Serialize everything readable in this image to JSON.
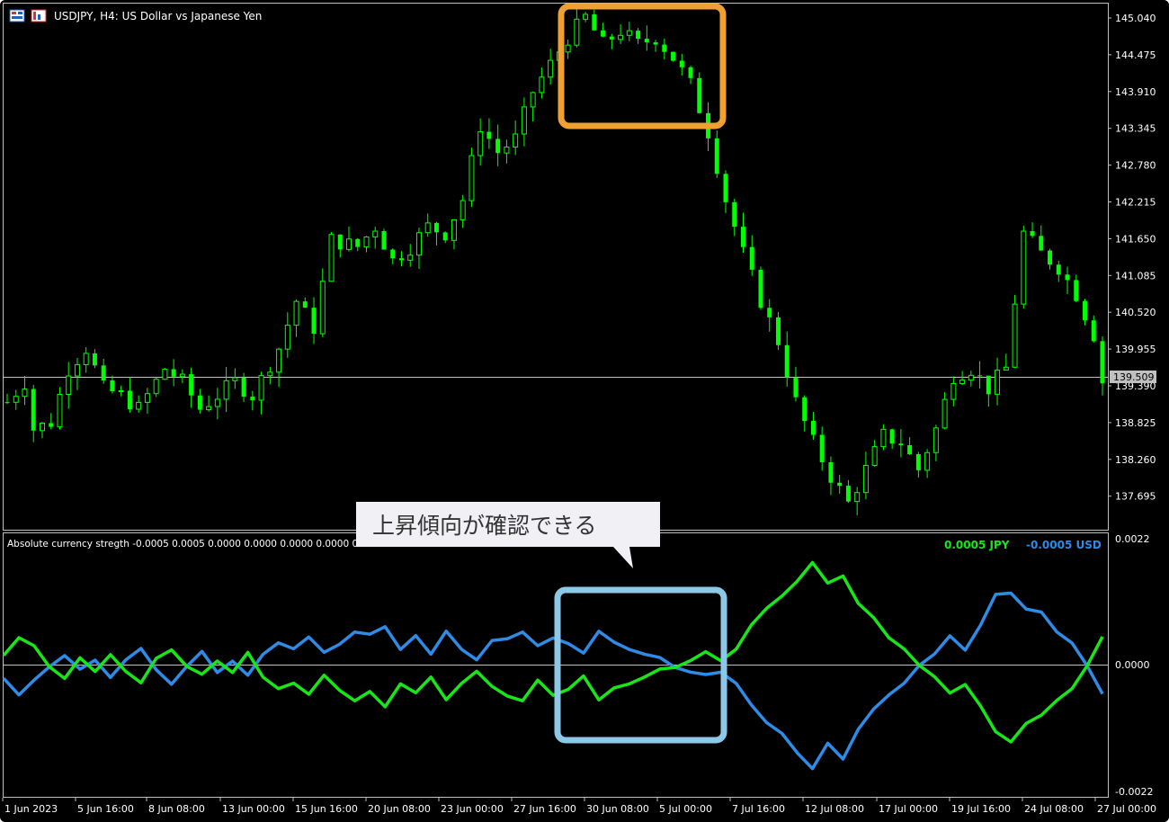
{
  "window": {
    "symbol_title": "USDJPY, H4:  US Dollar vs Japanese Yen",
    "current_price": "139.509"
  },
  "colors": {
    "background": "#000000",
    "candle": "#00ff00",
    "jpy": "#19e619",
    "usd": "#2e8be6",
    "grid": "#c0c0c0",
    "highlight_top": "#f0a030",
    "highlight_bottom": "#8cc8e8",
    "price_tag_bg": "#c0c0c0"
  },
  "price_axis": [
    "145.040",
    "144.475",
    "143.910",
    "143.345",
    "142.780",
    "142.215",
    "141.650",
    "141.085",
    "140.520",
    "139.955",
    "139.390",
    "138.825",
    "138.260",
    "137.695"
  ],
  "indicator": {
    "label": "Absolute currency stregth -0.0005 0.0005 0.0000 0.0000 0.0000 0.0000 0.0000 0.0000",
    "jpy_legend": "0.0005 JPY",
    "usd_legend": "-0.0005 USD",
    "axis": [
      "0.0022",
      "0.0000",
      "-0.0022"
    ]
  },
  "time_axis": [
    "1 Jun 2023",
    "5 Jun 16:00",
    "8 Jun 08:00",
    "13 Jun 00:00",
    "15 Jun 16:00",
    "20 Jun 08:00",
    "23 Jun 00:00",
    "27 Jun 16:00",
    "30 Jun 08:00",
    "5 Jul 00:00",
    "7 Jul 16:00",
    "12 Jul 08:00",
    "17 Jul 00:00",
    "19 Jul 16:00",
    "24 Jul 08:00",
    "27 Jul 00:00"
  ],
  "callout": {
    "text": "上昇傾向が確認できる"
  },
  "chart_data": [
    {
      "type": "candlestick",
      "title": "USDJPY, H4:  US Dollar vs Japanese Yen",
      "ylim": [
        137.45,
        145.15
      ],
      "x": [
        "1 Jun 2023",
        "5 Jun 16:00",
        "8 Jun 08:00",
        "13 Jun 00:00",
        "15 Jun 16:00",
        "20 Jun 08:00",
        "23 Jun 00:00",
        "27 Jun 16:00",
        "30 Jun 08:00",
        "5 Jul 00:00",
        "7 Jul 16:00",
        "12 Jul 08:00",
        "17 Jul 00:00",
        "19 Jul 16:00",
        "24 Jul 08:00",
        "27 Jul 00:00"
      ],
      "path": [
        [
          0,
          139.3
        ],
        [
          2,
          139.6
        ],
        [
          3,
          138.9
        ],
        [
          5,
          139.0
        ],
        [
          7,
          139.8
        ],
        [
          9,
          140.1
        ],
        [
          11,
          139.5
        ],
        [
          13,
          139.4
        ],
        [
          15,
          139.2
        ],
        [
          18,
          139.8
        ],
        [
          20,
          139.6
        ],
        [
          22,
          139.2
        ],
        [
          24,
          139.4
        ],
        [
          26,
          139.6
        ],
        [
          28,
          139.4
        ],
        [
          31,
          140.1
        ],
        [
          33,
          140.8
        ],
        [
          35,
          140.4
        ],
        [
          37,
          141.7
        ],
        [
          40,
          141.6
        ],
        [
          42,
          141.9
        ],
        [
          44,
          141.4
        ],
        [
          46,
          141.6
        ],
        [
          48,
          141.9
        ],
        [
          50,
          141.8
        ],
        [
          52,
          142.3
        ],
        [
          54,
          143.4
        ],
        [
          56,
          143.0
        ],
        [
          58,
          143.2
        ],
        [
          60,
          143.9
        ],
        [
          62,
          144.3
        ],
        [
          64,
          144.7
        ],
        [
          66,
          145.0
        ],
        [
          68,
          144.6
        ],
        [
          70,
          144.8
        ],
        [
          72,
          144.6
        ],
        [
          74,
          144.7
        ],
        [
          76,
          144.4
        ],
        [
          78,
          144.0
        ],
        [
          80,
          143.3
        ],
        [
          82,
          142.3
        ],
        [
          84,
          141.5
        ],
        [
          86,
          140.8
        ],
        [
          88,
          140.2
        ],
        [
          90,
          139.3
        ],
        [
          92,
          138.7
        ],
        [
          94,
          138.2
        ],
        [
          96,
          137.8
        ],
        [
          98,
          138.3
        ],
        [
          100,
          138.8
        ],
        [
          102,
          138.7
        ],
        [
          104,
          138.3
        ],
        [
          106,
          138.9
        ],
        [
          108,
          139.7
        ],
        [
          110,
          139.8
        ],
        [
          112,
          139.5
        ],
        [
          114,
          139.8
        ],
        [
          116,
          141.8
        ],
        [
          118,
          141.5
        ],
        [
          120,
          141.3
        ],
        [
          122,
          140.9
        ],
        [
          124,
          140.3
        ],
        [
          125,
          139.6
        ]
      ],
      "candle_count": 126
    },
    {
      "type": "line",
      "title": "Absolute currency stregth -0.0005 0.0005 0.0000 0.0000 0.0000 0.0000 0.0000 0.0000",
      "ylim": [
        -0.0022,
        0.0022
      ],
      "series": [
        {
          "name": "JPY",
          "color": "#19e619",
          "values": [
            0.0002,
            0.0005,
            0.0003,
            0.0,
            -0.0002,
            0.0001,
            -0.0001,
            0.0002,
            -0.0001,
            -0.0003,
            0.0001,
            0.0003,
            0.0,
            -0.0002,
            0.0001,
            -0.0001,
            0.0002,
            -0.0002,
            -0.0004,
            -0.0003,
            -0.0005,
            -0.0002,
            -0.0004,
            -0.0006,
            -0.0005,
            -0.0007,
            -0.0003,
            -0.0005,
            -0.0002,
            -0.0006,
            -0.0003,
            -0.0001,
            -0.0004,
            -0.0005,
            -0.0006,
            -0.0003,
            -0.0005,
            -0.0004,
            -0.0002,
            -0.0006,
            -0.0004,
            -0.0003,
            -0.0002,
            -0.0001,
            0.0,
            0.0001,
            0.0002,
            0.0001,
            0.0003,
            0.0007,
            0.001,
            0.0012,
            0.0015,
            0.0018,
            0.0014,
            0.0016,
            0.0011,
            0.0008,
            0.0005,
            0.0003,
            0.0,
            -0.0002,
            -0.0005,
            -0.0003,
            -0.0007,
            -0.0012,
            -0.0013,
            -0.001,
            -0.0009,
            -0.0006,
            -0.0004,
            0.0,
            0.0005
          ]
        },
        {
          "name": "USD",
          "color": "#2e8be6",
          "values": [
            -0.0002,
            -0.0005,
            -0.0003,
            0.0,
            0.0002,
            -0.0001,
            0.0001,
            -0.0002,
            0.0001,
            0.0003,
            -0.0001,
            -0.0003,
            0.0,
            0.0002,
            -0.0001,
            0.0001,
            -0.0002,
            0.0002,
            0.0004,
            0.0003,
            0.0005,
            0.0002,
            0.0004,
            0.0006,
            0.0005,
            0.0007,
            0.0003,
            0.0005,
            0.0002,
            0.0006,
            0.0003,
            0.0001,
            0.0004,
            0.0005,
            0.0006,
            0.0003,
            0.0005,
            0.0004,
            0.0002,
            0.0006,
            0.0004,
            0.0003,
            0.0002,
            0.0001,
            0.0,
            -0.0001,
            -0.0002,
            -0.0001,
            -0.0003,
            -0.0007,
            -0.001,
            -0.0012,
            -0.0015,
            -0.0018,
            -0.0014,
            -0.0016,
            -0.0011,
            -0.0008,
            -0.0005,
            -0.0003,
            0.0,
            0.0002,
            0.0005,
            0.0003,
            0.0007,
            0.0012,
            0.0013,
            0.001,
            0.0009,
            0.0006,
            0.0004,
            0.0,
            -0.0005
          ]
        }
      ]
    }
  ]
}
